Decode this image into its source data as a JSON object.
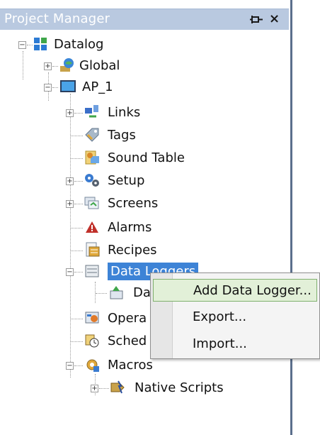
{
  "panel": {
    "title": "Project Manager",
    "pin_icon": "pin-icon",
    "close_glyph": "×"
  },
  "tree": {
    "root": "Datalog",
    "global": "Global",
    "ap": "AP_1",
    "links": "Links",
    "tags": "Tags",
    "sound_table": "Sound Table",
    "setup": "Setup",
    "screens": "Screens",
    "alarms": "Alarms",
    "recipes": "Recipes",
    "data_loggers": "Data Loggers",
    "data_logger_child": "Da",
    "operator": "Opera",
    "scheduler": "Sched",
    "macros": "Macros",
    "native_scripts": "Native Scripts"
  },
  "context_menu": {
    "items": [
      "Add Data Logger...",
      "Export...",
      "Import..."
    ]
  },
  "colors": {
    "titlebar": "#b9c9e0",
    "selection": "#3d83d6",
    "menu_highlight": "#e2f0d8"
  }
}
